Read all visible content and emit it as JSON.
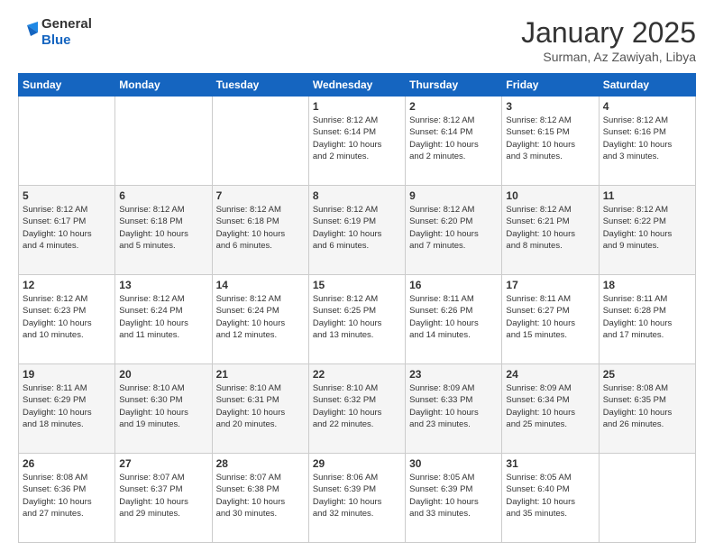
{
  "header": {
    "logo_line1": "General",
    "logo_line2": "Blue",
    "month_title": "January 2025",
    "location": "Surman, Az Zawiyah, Libya"
  },
  "weekdays": [
    "Sunday",
    "Monday",
    "Tuesday",
    "Wednesday",
    "Thursday",
    "Friday",
    "Saturday"
  ],
  "weeks": [
    [
      {
        "day": "",
        "info": ""
      },
      {
        "day": "",
        "info": ""
      },
      {
        "day": "",
        "info": ""
      },
      {
        "day": "1",
        "info": "Sunrise: 8:12 AM\nSunset: 6:14 PM\nDaylight: 10 hours\nand 2 minutes."
      },
      {
        "day": "2",
        "info": "Sunrise: 8:12 AM\nSunset: 6:14 PM\nDaylight: 10 hours\nand 2 minutes."
      },
      {
        "day": "3",
        "info": "Sunrise: 8:12 AM\nSunset: 6:15 PM\nDaylight: 10 hours\nand 3 minutes."
      },
      {
        "day": "4",
        "info": "Sunrise: 8:12 AM\nSunset: 6:16 PM\nDaylight: 10 hours\nand 3 minutes."
      }
    ],
    [
      {
        "day": "5",
        "info": "Sunrise: 8:12 AM\nSunset: 6:17 PM\nDaylight: 10 hours\nand 4 minutes."
      },
      {
        "day": "6",
        "info": "Sunrise: 8:12 AM\nSunset: 6:18 PM\nDaylight: 10 hours\nand 5 minutes."
      },
      {
        "day": "7",
        "info": "Sunrise: 8:12 AM\nSunset: 6:18 PM\nDaylight: 10 hours\nand 6 minutes."
      },
      {
        "day": "8",
        "info": "Sunrise: 8:12 AM\nSunset: 6:19 PM\nDaylight: 10 hours\nand 6 minutes."
      },
      {
        "day": "9",
        "info": "Sunrise: 8:12 AM\nSunset: 6:20 PM\nDaylight: 10 hours\nand 7 minutes."
      },
      {
        "day": "10",
        "info": "Sunrise: 8:12 AM\nSunset: 6:21 PM\nDaylight: 10 hours\nand 8 minutes."
      },
      {
        "day": "11",
        "info": "Sunrise: 8:12 AM\nSunset: 6:22 PM\nDaylight: 10 hours\nand 9 minutes."
      }
    ],
    [
      {
        "day": "12",
        "info": "Sunrise: 8:12 AM\nSunset: 6:23 PM\nDaylight: 10 hours\nand 10 minutes."
      },
      {
        "day": "13",
        "info": "Sunrise: 8:12 AM\nSunset: 6:24 PM\nDaylight: 10 hours\nand 11 minutes."
      },
      {
        "day": "14",
        "info": "Sunrise: 8:12 AM\nSunset: 6:24 PM\nDaylight: 10 hours\nand 12 minutes."
      },
      {
        "day": "15",
        "info": "Sunrise: 8:12 AM\nSunset: 6:25 PM\nDaylight: 10 hours\nand 13 minutes."
      },
      {
        "day": "16",
        "info": "Sunrise: 8:11 AM\nSunset: 6:26 PM\nDaylight: 10 hours\nand 14 minutes."
      },
      {
        "day": "17",
        "info": "Sunrise: 8:11 AM\nSunset: 6:27 PM\nDaylight: 10 hours\nand 15 minutes."
      },
      {
        "day": "18",
        "info": "Sunrise: 8:11 AM\nSunset: 6:28 PM\nDaylight: 10 hours\nand 17 minutes."
      }
    ],
    [
      {
        "day": "19",
        "info": "Sunrise: 8:11 AM\nSunset: 6:29 PM\nDaylight: 10 hours\nand 18 minutes."
      },
      {
        "day": "20",
        "info": "Sunrise: 8:10 AM\nSunset: 6:30 PM\nDaylight: 10 hours\nand 19 minutes."
      },
      {
        "day": "21",
        "info": "Sunrise: 8:10 AM\nSunset: 6:31 PM\nDaylight: 10 hours\nand 20 minutes."
      },
      {
        "day": "22",
        "info": "Sunrise: 8:10 AM\nSunset: 6:32 PM\nDaylight: 10 hours\nand 22 minutes."
      },
      {
        "day": "23",
        "info": "Sunrise: 8:09 AM\nSunset: 6:33 PM\nDaylight: 10 hours\nand 23 minutes."
      },
      {
        "day": "24",
        "info": "Sunrise: 8:09 AM\nSunset: 6:34 PM\nDaylight: 10 hours\nand 25 minutes."
      },
      {
        "day": "25",
        "info": "Sunrise: 8:08 AM\nSunset: 6:35 PM\nDaylight: 10 hours\nand 26 minutes."
      }
    ],
    [
      {
        "day": "26",
        "info": "Sunrise: 8:08 AM\nSunset: 6:36 PM\nDaylight: 10 hours\nand 27 minutes."
      },
      {
        "day": "27",
        "info": "Sunrise: 8:07 AM\nSunset: 6:37 PM\nDaylight: 10 hours\nand 29 minutes."
      },
      {
        "day": "28",
        "info": "Sunrise: 8:07 AM\nSunset: 6:38 PM\nDaylight: 10 hours\nand 30 minutes."
      },
      {
        "day": "29",
        "info": "Sunrise: 8:06 AM\nSunset: 6:39 PM\nDaylight: 10 hours\nand 32 minutes."
      },
      {
        "day": "30",
        "info": "Sunrise: 8:05 AM\nSunset: 6:39 PM\nDaylight: 10 hours\nand 33 minutes."
      },
      {
        "day": "31",
        "info": "Sunrise: 8:05 AM\nSunset: 6:40 PM\nDaylight: 10 hours\nand 35 minutes."
      },
      {
        "day": "",
        "info": ""
      }
    ]
  ]
}
